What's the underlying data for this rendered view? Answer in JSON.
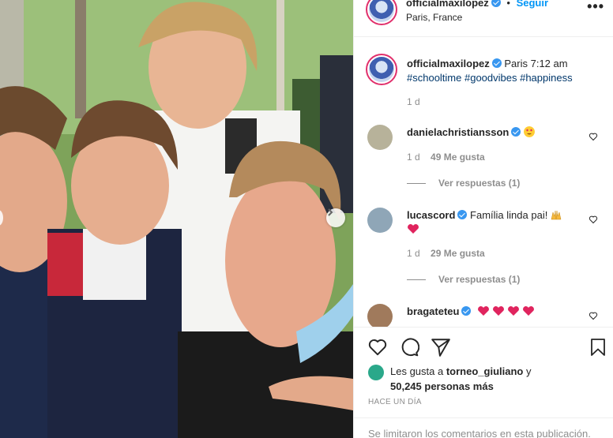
{
  "post": {
    "photo_alt": "selfie",
    "next_arrow": "chevron-right-icon"
  },
  "header": {
    "username": "officialmaxilopez",
    "separator": "•",
    "follow_label": "Seguir",
    "location": "Paris, France",
    "more_icon": "more-horizontal-icon",
    "more_label": "•••"
  },
  "caption": {
    "username": "officialmaxilopez",
    "text": "Paris 7:12 am",
    "hashtags": "#schooltime #goodvibes #happiness",
    "time": "1 d"
  },
  "comments": [
    {
      "username": "danielachristiansson",
      "emoji": "smiling-face-with-heart-eyes",
      "time": "1 d",
      "likes": "49 Me gusta",
      "replies": "Ver respuestas (1)"
    },
    {
      "username": "lucascord",
      "text": "Família linda pai!",
      "emoji": "raising-hands",
      "second_line_emoji": "red-heart",
      "time": "1 d",
      "likes": "29 Me gusta",
      "replies": "Ver respuestas (1)"
    },
    {
      "username": "bragateteu",
      "emoji": "red-heart",
      "heart_count": 4
    }
  ],
  "actions": {
    "like_icon": "heart-icon",
    "comment_icon": "comment-icon",
    "share_icon": "send-icon",
    "save_icon": "bookmark-icon"
  },
  "likes": {
    "prefix": "Les gusta a",
    "user": "torneo_giuliano",
    "joiner": "y",
    "count": "50,245 personas más"
  },
  "posted_ago": "HACE UN DÍA",
  "comments_limited": "Se limitaron los comentarios en esta publicación.",
  "colors": {
    "verified": "#3897f0",
    "link": "#0095f6",
    "hashtag": "#00376b",
    "muted": "#8e8e8e",
    "heart": "#ed4956"
  }
}
